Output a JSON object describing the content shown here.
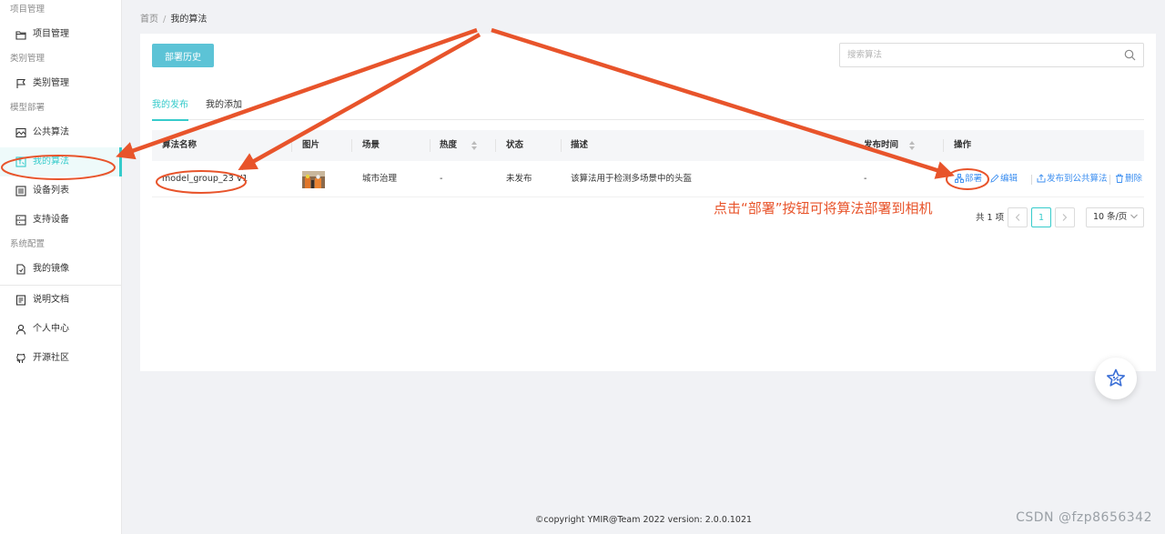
{
  "sidebar": {
    "groups": [
      {
        "label": "项目管理",
        "items": [
          {
            "label": "项目管理",
            "icon": "folder-icon"
          }
        ]
      },
      {
        "label": "类别管理",
        "items": [
          {
            "label": "类别管理",
            "icon": "flag-icon"
          }
        ]
      },
      {
        "label": "模型部署",
        "items": [
          {
            "label": "公共算法",
            "icon": "image-icon"
          },
          {
            "label": "我的算法",
            "icon": "my-algorithm-icon",
            "active": true
          },
          {
            "label": "设备列表",
            "icon": "device-list-icon"
          },
          {
            "label": "支持设备",
            "icon": "support-device-icon"
          }
        ]
      },
      {
        "label": "系统配置",
        "items": [
          {
            "label": "我的镜像",
            "icon": "mirror-file-icon"
          }
        ]
      }
    ],
    "bottom_items": [
      {
        "label": "说明文档",
        "icon": "doc-icon"
      },
      {
        "label": "个人中心",
        "icon": "user-icon"
      },
      {
        "label": "开源社区",
        "icon": "github-icon"
      }
    ]
  },
  "breadcrumb": {
    "home": "首页",
    "separator": "/",
    "current": "我的算法"
  },
  "toolbar": {
    "history_label": "部署历史",
    "search_placeholder": "搜索算法"
  },
  "tabs": [
    {
      "label": "我的发布",
      "active": true
    },
    {
      "label": "我的添加",
      "active": false
    }
  ],
  "table": {
    "headers": {
      "name": "算法名称",
      "image": "图片",
      "scene": "场景",
      "heat": "热度",
      "status": "状态",
      "description": "描述",
      "publish_time": "发布时间",
      "actions": "操作"
    },
    "rows": [
      {
        "name": "model_group_23 V1",
        "scene": "城市治理",
        "heat": "-",
        "status": "未发布",
        "description": "该算法用于检测多场景中的头盔",
        "publish_time": "-"
      }
    ],
    "row_actions": [
      {
        "label": "部署",
        "icon": "deploy-icon"
      },
      {
        "label": "编辑",
        "icon": "edit-icon"
      },
      {
        "label": "发布到公共算法",
        "icon": "publish-icon"
      },
      {
        "label": "删除",
        "icon": "delete-icon"
      }
    ]
  },
  "pagination": {
    "total": "共 1 项",
    "current_page": "1",
    "page_size": "10 条/页"
  },
  "annotation": {
    "note": "点击“部署”按钮可将算法部署到相机"
  },
  "footer": {
    "copyright": "©copyright YMIR@Team 2022 version: 2.0.0.1021"
  },
  "watermark": "CSDN @fzp8656342",
  "colors": {
    "primary": "#36cbcb",
    "link": "#3b8ef0",
    "button": "#5cc3d6",
    "annotation": "#e8542b"
  }
}
